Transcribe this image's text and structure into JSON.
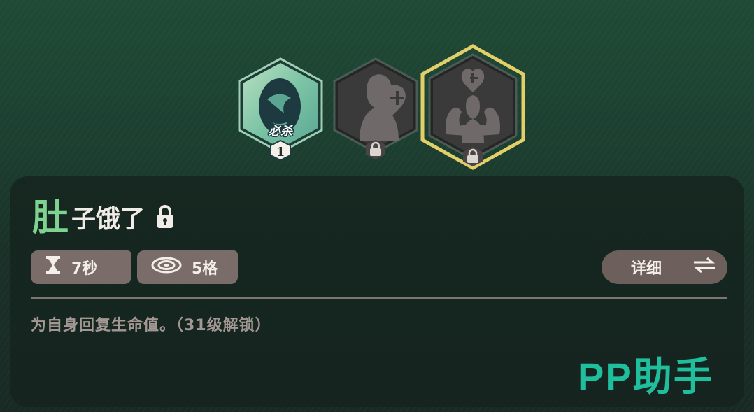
{
  "skills": [
    {
      "icon": "dragon-egg-icon",
      "badge_label": "必杀",
      "badge_number": "1",
      "state": "unlocked"
    },
    {
      "icon": "knight-heal-icon",
      "state": "locked"
    },
    {
      "icon": "knight-flex-heal-icon",
      "state": "locked-selected"
    }
  ],
  "skill_detail": {
    "title_first_char": "肚",
    "title_rest": "子饿了",
    "cooldown": "7秒",
    "range": "5格",
    "detail_button": "详细",
    "description": "为自身回复生命值。（31级解锁）"
  },
  "watermark": "PP助手",
  "colors": {
    "title_accent": "#7fd391",
    "selected_border": "#e3cf6a",
    "watermark": "#1fbf9e"
  }
}
